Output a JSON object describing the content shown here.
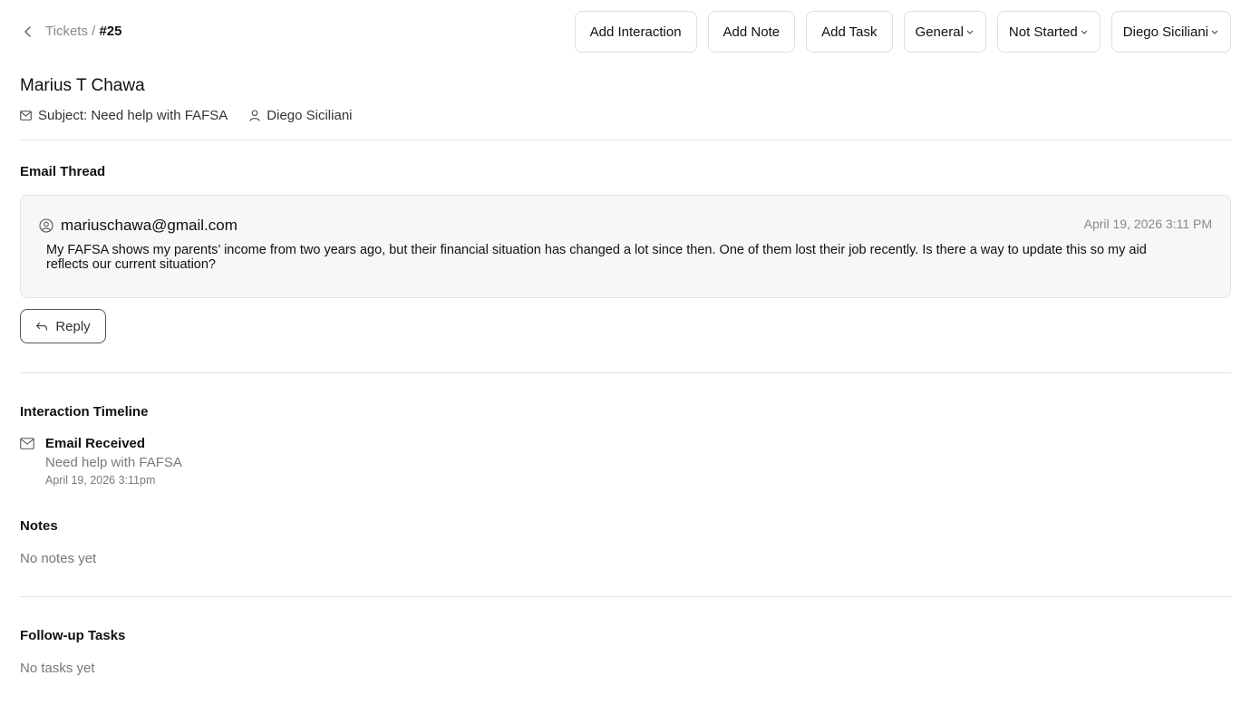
{
  "breadcrumb": {
    "root": "Tickets",
    "separator": "/",
    "current": "#25"
  },
  "toolbar": {
    "add_interaction": "Add Interaction",
    "add_note": "Add Note",
    "add_task": "Add Task",
    "category": "General",
    "status": "Not Started",
    "assignee": "Diego Siciliani"
  },
  "ticket": {
    "contact_name": "Marius T Chawa",
    "subject": "Subject: Need help with FAFSA",
    "owner": "Diego Siciliani"
  },
  "email_thread": {
    "heading": "Email Thread",
    "messages": [
      {
        "from": "mariuschawa@gmail.com",
        "date": "April 19, 2026 3:11 PM",
        "body": "My FAFSA shows my parents’ income from two years ago, but their financial situation has changed a lot since then. One of them lost their job recently. Is there a way to update this so my aid reflects our current situation?"
      }
    ],
    "reply_label": "Reply"
  },
  "timeline": {
    "heading": "Interaction Timeline",
    "items": [
      {
        "title": "Email Received",
        "subtitle": "Need help with FAFSA",
        "date": "April 19, 2026 3:11pm",
        "icon": "mail-icon"
      }
    ]
  },
  "notes": {
    "heading": "Notes",
    "empty": "No notes yet"
  },
  "tasks": {
    "heading": "Follow-up Tasks",
    "empty": "No tasks yet"
  }
}
